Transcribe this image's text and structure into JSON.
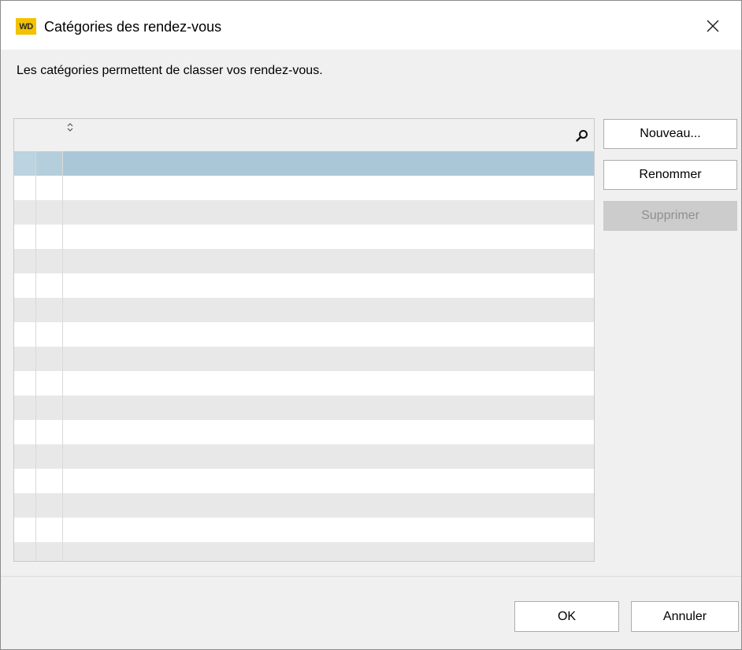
{
  "window": {
    "title": "Catégories des rendez-vous",
    "app_badge": "WD",
    "close_glyph": "✕"
  },
  "description": "Les catégories permettent de classer vos rendez-vous.",
  "table": {
    "columns": [
      "",
      "",
      ""
    ],
    "rows": [],
    "icons": [
      "sort-icon",
      "search-icon"
    ]
  },
  "buttons": {
    "new_label": "Nouveau...",
    "rename_label": "Renommer",
    "delete_label": "Supprimer",
    "ok_label": "OK",
    "cancel_label": "Annuler"
  },
  "colors": {
    "selected_row": "#aac7d7",
    "alternate_row": "#e8e8e8",
    "app_icon": "#f2c200",
    "disabled_button": "#cccccc"
  }
}
